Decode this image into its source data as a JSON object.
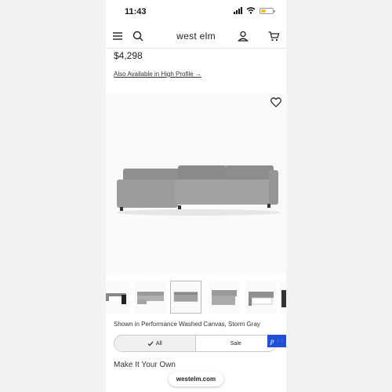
{
  "status_bar": {
    "time": "11:43",
    "battery_level": 0.4,
    "battery_color": "#f4c430"
  },
  "nav": {
    "brand": "west elm",
    "icons": [
      "menu-icon",
      "search-icon",
      "account-icon",
      "cart-icon"
    ]
  },
  "product": {
    "price": "$4,298",
    "profile_link": "Also Available in High Profile →",
    "image_caption": "Shown in Performance Washed Canvas, Storm Gray",
    "favorite_icon": "heart-icon"
  },
  "thumbnails": {
    "selected_index": 2,
    "count": 6
  },
  "filter": {
    "options": [
      {
        "label": "All",
        "selected": true,
        "icon": "check-icon"
      },
      {
        "label": "Sale",
        "selected": false
      }
    ]
  },
  "badge": {
    "letter": "p",
    "color": "#1f4fd6"
  },
  "section": {
    "title": "Make It Your Own"
  },
  "browser": {
    "url": "westelm.com"
  }
}
